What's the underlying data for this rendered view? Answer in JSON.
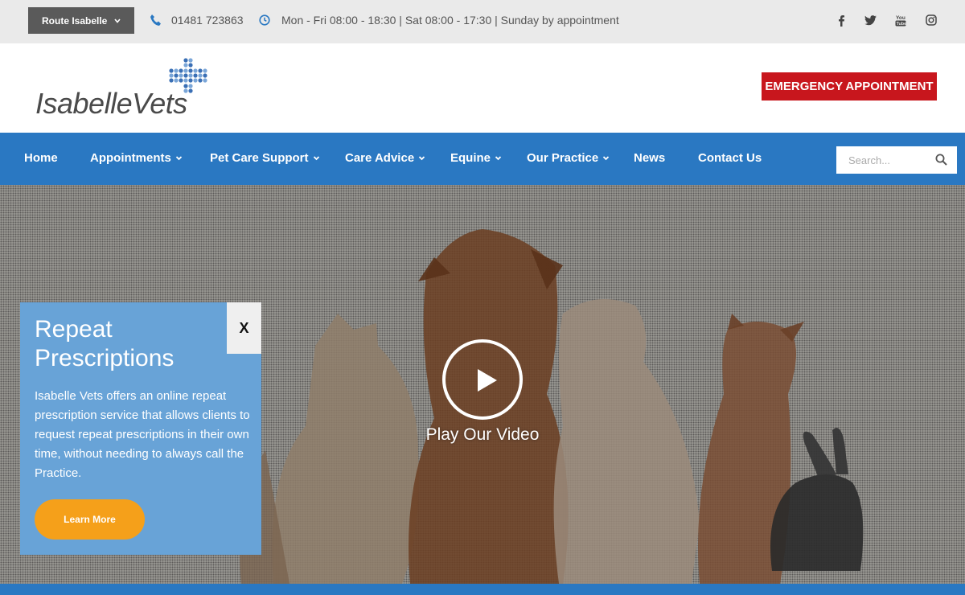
{
  "topbar": {
    "location_label": "Route Isabelle",
    "phone": "01481 723863",
    "hours": "Mon - Fri 08:00 - 18:30 | Sat 08:00 - 17:30 | Sunday by appointment",
    "social_icons": [
      "facebook-icon",
      "twitter-icon",
      "youtube-icon",
      "instagram-icon"
    ]
  },
  "header": {
    "logo_text": "IsabelleVets",
    "emergency_label": "EMERGENCY APPOINTMENT"
  },
  "nav": {
    "items": [
      {
        "label": "Home",
        "has_dropdown": false
      },
      {
        "label": "Appointments",
        "has_dropdown": true
      },
      {
        "label": "Pet Care Support",
        "has_dropdown": true
      },
      {
        "label": "Care Advice",
        "has_dropdown": true
      },
      {
        "label": "Equine",
        "has_dropdown": true
      },
      {
        "label": "Our Practice",
        "has_dropdown": true
      },
      {
        "label": "News",
        "has_dropdown": false
      },
      {
        "label": "Contact Us",
        "has_dropdown": false
      }
    ],
    "search_placeholder": "Search..."
  },
  "hero": {
    "play_label": "Play Our Video"
  },
  "popup": {
    "title": "Repeat Prescriptions",
    "body": "Isabelle Vets offers an online repeat prescription service that allows clients to request repeat prescriptions in their own time, without needing to always call the Practice.",
    "close_label": "X",
    "button_label": "Learn More"
  },
  "colors": {
    "nav_blue": "#2a78c2",
    "emergency_red": "#c8161d",
    "popup_blue": "#68a3d7",
    "learn_orange": "#f5a01a",
    "topbar_gray": "#eaeaea"
  }
}
